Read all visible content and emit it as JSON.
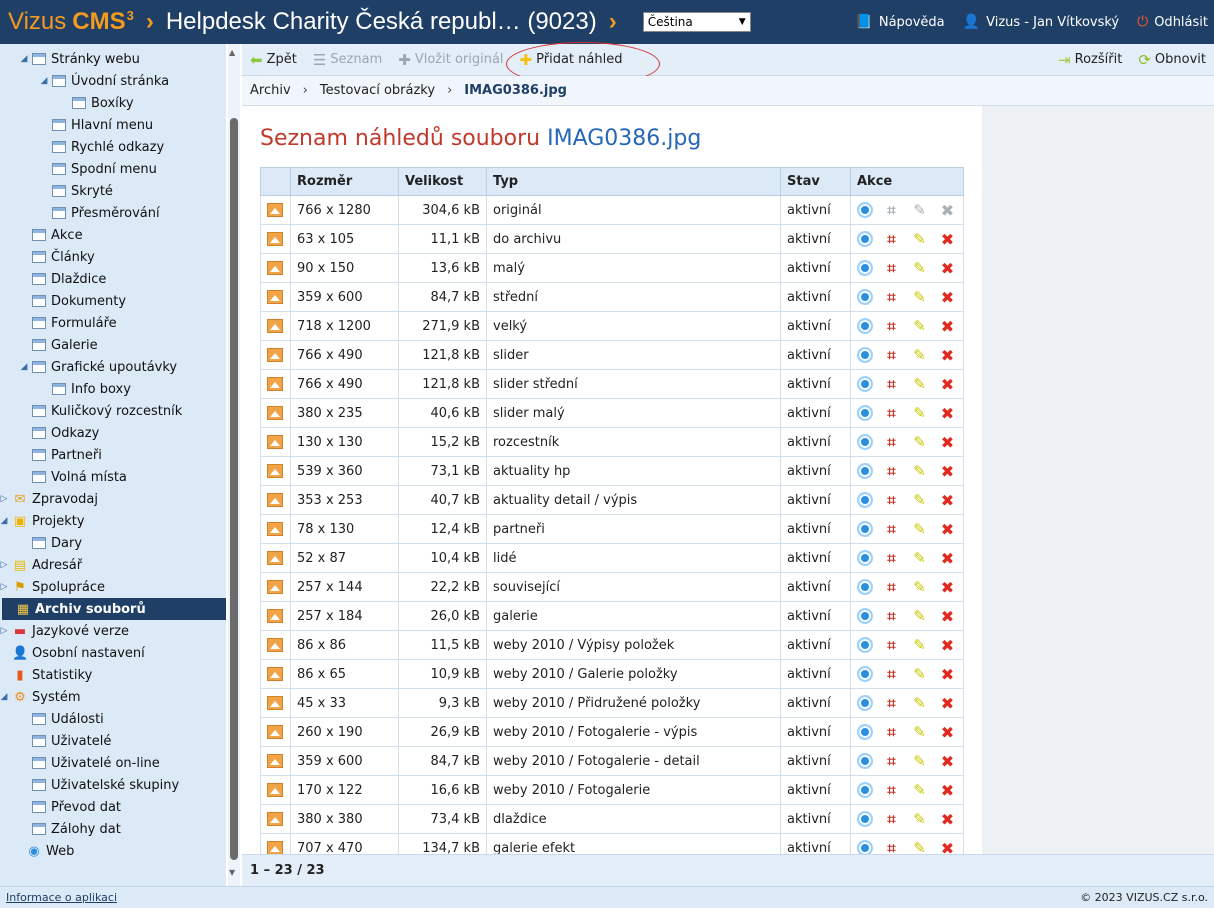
{
  "header": {
    "brand_name": "Vizus",
    "brand_product": "CMS",
    "brand_version": "3",
    "separator": "›",
    "site_title": "Helpdesk Charity Česká republ… (9023)",
    "language": "Čeština",
    "help": "Nápověda",
    "user": "Vizus - Jan Vítkovský",
    "logout": "Odhlásit"
  },
  "sidebar": {
    "items": [
      {
        "label": "Stránky webu",
        "level": 1,
        "expander": "◢",
        "icon": "page"
      },
      {
        "label": "Úvodní stránka",
        "level": 2,
        "expander": "◢",
        "icon": "page"
      },
      {
        "label": "Boxíky",
        "level": 3,
        "icon": "page"
      },
      {
        "label": "Hlavní menu",
        "level": 2,
        "icon": "page"
      },
      {
        "label": "Rychlé odkazy",
        "level": 2,
        "icon": "page"
      },
      {
        "label": "Spodní menu",
        "level": 2,
        "icon": "page"
      },
      {
        "label": "Skryté",
        "level": 2,
        "icon": "page"
      },
      {
        "label": "Přesměrování",
        "level": 2,
        "icon": "page"
      },
      {
        "label": "Akce",
        "level": 1,
        "icon": "page"
      },
      {
        "label": "Články",
        "level": 1,
        "icon": "page"
      },
      {
        "label": "Dlaždice",
        "level": 1,
        "icon": "page"
      },
      {
        "label": "Dokumenty",
        "level": 1,
        "icon": "page"
      },
      {
        "label": "Formuláře",
        "level": 1,
        "icon": "page"
      },
      {
        "label": "Galerie",
        "level": 1,
        "icon": "page"
      },
      {
        "label": "Grafické upoutávky",
        "level": 1,
        "expander": "◢",
        "icon": "page"
      },
      {
        "label": "Info boxy",
        "level": 2,
        "icon": "page"
      },
      {
        "label": "Kuličkový rozcestník",
        "level": 1,
        "icon": "page"
      },
      {
        "label": "Odkazy",
        "level": 1,
        "icon": "page"
      },
      {
        "label": "Partneři",
        "level": 1,
        "icon": "page"
      },
      {
        "label": "Volná místa",
        "level": 1,
        "icon": "page"
      },
      {
        "label": "Zpravodaj",
        "level": 0,
        "expander": "▷",
        "icon": "envelope"
      },
      {
        "label": "Projekty",
        "level": 0,
        "expander": "◢",
        "icon": "projects"
      },
      {
        "label": "Dary",
        "level": 1,
        "icon": "page"
      },
      {
        "label": "Adresář",
        "level": 0,
        "expander": "▷",
        "icon": "addressbook"
      },
      {
        "label": "Spolupráce",
        "level": 0,
        "expander": "▷",
        "icon": "cooperation"
      },
      {
        "label": "Archiv souborů",
        "level": 0,
        "icon": "archive",
        "active": true
      },
      {
        "label": "Jazykové verze",
        "level": 0,
        "expander": "▷",
        "icon": "flag"
      },
      {
        "label": "Osobní nastavení",
        "level": 0,
        "icon": "user"
      },
      {
        "label": "Statistiky",
        "level": 0,
        "icon": "stats"
      },
      {
        "label": "Systém",
        "level": 0,
        "expander": "◢",
        "icon": "gear"
      },
      {
        "label": "Události",
        "level": 1,
        "icon": "page"
      },
      {
        "label": "Uživatelé",
        "level": 1,
        "icon": "page"
      },
      {
        "label": "Uživatelé on-line",
        "level": 1,
        "icon": "page"
      },
      {
        "label": "Uživatelské skupiny",
        "level": 1,
        "icon": "page"
      },
      {
        "label": "Převod dat",
        "level": 1,
        "icon": "page"
      },
      {
        "label": "Zálohy dat",
        "level": 1,
        "icon": "page"
      },
      {
        "label": "Web",
        "level": -1,
        "icon": "globe"
      }
    ]
  },
  "toolbar": {
    "back": "Zpět",
    "list": "Seznam",
    "insert_original": "Vložit originál",
    "add_preview": "Přidat náhled",
    "expand": "Rozšířit",
    "refresh": "Obnovit"
  },
  "breadcrumb": {
    "items": [
      "Archiv",
      "Testovací obrázky"
    ],
    "current": "IMAG0386.jpg",
    "separator": "›"
  },
  "main": {
    "title_prefix": "Seznam náhledů souboru",
    "title_file": "IMAG0386.jpg",
    "columns": [
      "Rozměr",
      "Velikost",
      "Typ",
      "Stav",
      "Akce"
    ],
    "rows": [
      {
        "size": "766 x 1280",
        "bytes": "304,6 kB",
        "type": "originál",
        "state": "aktivní",
        "original": true
      },
      {
        "size": "63 x 105",
        "bytes": "11,1 kB",
        "type": "do archivu",
        "state": "aktivní"
      },
      {
        "size": "90 x 150",
        "bytes": "13,6 kB",
        "type": "malý",
        "state": "aktivní"
      },
      {
        "size": "359 x 600",
        "bytes": "84,7 kB",
        "type": "střední",
        "state": "aktivní"
      },
      {
        "size": "718 x 1200",
        "bytes": "271,9 kB",
        "type": "velký",
        "state": "aktivní"
      },
      {
        "size": "766 x 490",
        "bytes": "121,8 kB",
        "type": "slider",
        "state": "aktivní"
      },
      {
        "size": "766 x 490",
        "bytes": "121,8 kB",
        "type": "slider střední",
        "state": "aktivní"
      },
      {
        "size": "380 x 235",
        "bytes": "40,6 kB",
        "type": "slider malý",
        "state": "aktivní"
      },
      {
        "size": "130 x 130",
        "bytes": "15,2 kB",
        "type": "rozcestník",
        "state": "aktivní"
      },
      {
        "size": "539 x 360",
        "bytes": "73,1 kB",
        "type": "aktuality hp",
        "state": "aktivní"
      },
      {
        "size": "353 x 253",
        "bytes": "40,7 kB",
        "type": "aktuality detail / výpis",
        "state": "aktivní"
      },
      {
        "size": "78 x 130",
        "bytes": "12,4 kB",
        "type": "partneři",
        "state": "aktivní"
      },
      {
        "size": "52 x 87",
        "bytes": "10,4 kB",
        "type": "lidé",
        "state": "aktivní"
      },
      {
        "size": "257 x 144",
        "bytes": "22,2 kB",
        "type": "související",
        "state": "aktivní"
      },
      {
        "size": "257 x 184",
        "bytes": "26,0 kB",
        "type": "galerie",
        "state": "aktivní"
      },
      {
        "size": "86 x 86",
        "bytes": "11,5 kB",
        "type": "weby 2010 / Výpisy položek",
        "state": "aktivní"
      },
      {
        "size": "86 x 65",
        "bytes": "10,9 kB",
        "type": "weby 2010 / Galerie položky",
        "state": "aktivní"
      },
      {
        "size": "45 x 33",
        "bytes": "9,3 kB",
        "type": "weby 2010 / Přidružené položky",
        "state": "aktivní"
      },
      {
        "size": "260 x 190",
        "bytes": "26,9 kB",
        "type": "weby 2010 / Fotogalerie - výpis",
        "state": "aktivní"
      },
      {
        "size": "359 x 600",
        "bytes": "84,7 kB",
        "type": "weby 2010 / Fotogalerie - detail",
        "state": "aktivní"
      },
      {
        "size": "170 x 122",
        "bytes": "16,6 kB",
        "type": "weby 2010 / Fotogalerie",
        "state": "aktivní"
      },
      {
        "size": "380 x 380",
        "bytes": "73,4 kB",
        "type": "dlaždice",
        "state": "aktivní"
      },
      {
        "size": "707 x 470",
        "bytes": "134,7 kB",
        "type": "galerie efekt",
        "state": "aktivní"
      }
    ]
  },
  "pager": {
    "text": "1 – 23 / 23"
  },
  "statusbar": {
    "about": "Informace o aplikaci",
    "copyright": "© 2023 VIZUS.CZ s.r.o."
  },
  "colors": {
    "header_bg": "#1f3f66",
    "brand_orange": "#f39a1f",
    "title_red": "#c0392b",
    "link_blue": "#2667b8"
  }
}
